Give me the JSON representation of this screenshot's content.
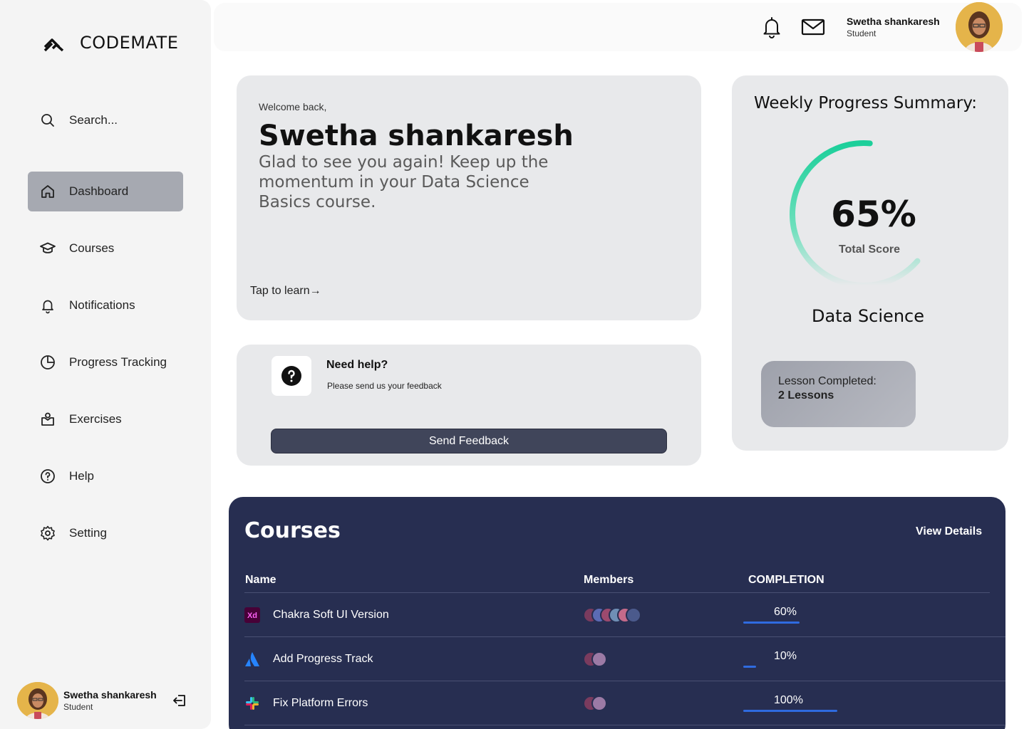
{
  "app": {
    "logo_text": "CODEMATE"
  },
  "sidebar": {
    "search_label": "Search...",
    "items": [
      {
        "label": "Dashboard",
        "icon": "home-icon",
        "active": true
      },
      {
        "label": "Courses",
        "icon": "graduation-cap-icon"
      },
      {
        "label": "Notifications",
        "icon": "bell-icon"
      },
      {
        "label": "Progress Tracking",
        "icon": "pie-chart-icon"
      },
      {
        "label": "Exercises",
        "icon": "exercise-icon"
      },
      {
        "label": "Help",
        "icon": "question-circle-icon"
      },
      {
        "label": "Setting",
        "icon": "gear-icon"
      }
    ],
    "user": {
      "name": "Swetha shankaresh",
      "role": "Student"
    }
  },
  "topbar": {
    "user_name": "Swetha shankaresh",
    "user_role": "Student"
  },
  "welcome": {
    "label": "Welcome back,",
    "name": "Swetha shankaresh",
    "message": "Glad to see you again! Keep up the momentum in your Data Science Basics course.",
    "tap_label": "Tap to learn→"
  },
  "help": {
    "title": "Need help?",
    "subtitle": "Please send us your feedback",
    "button_label": "Send Feedback"
  },
  "progress": {
    "title": "Weekly Progress Summary:",
    "percent_text": "65%",
    "percent_value": 65,
    "score_label": "Total Score",
    "course": "Data Science",
    "lesson_label": "Lesson Completed:",
    "lesson_count": "2 Lessons"
  },
  "courses": {
    "title": "Courses",
    "view_details": "View Details",
    "columns": {
      "name": "Name",
      "members": "Members",
      "completion": "COMPLETION"
    },
    "rows": [
      {
        "name": "Chakra Soft UI Version",
        "icon": "adobe-xd-icon",
        "members": [
          "#7a3b5e",
          "#5b6bb5",
          "#9c4a6e",
          "#6f8fb5",
          "#c46a8a",
          "#4b5a8c"
        ],
        "completion_text": "60%",
        "completion": 60
      },
      {
        "name": "Add Progress Track",
        "icon": "atlassian-icon",
        "members": [
          "#7a3b5e",
          "#9c7aa5"
        ],
        "completion_text": "10%",
        "completion": 10
      },
      {
        "name": "Fix Platform Errors",
        "icon": "slack-icon",
        "members": [
          "#7a3b5e",
          "#9c7aa5"
        ],
        "completion_text": "100%",
        "completion": 100
      }
    ]
  },
  "colors": {
    "accent_gauge": "#1ccf9a",
    "bar": "#2f6be0",
    "courses_bg": "#272e51"
  }
}
